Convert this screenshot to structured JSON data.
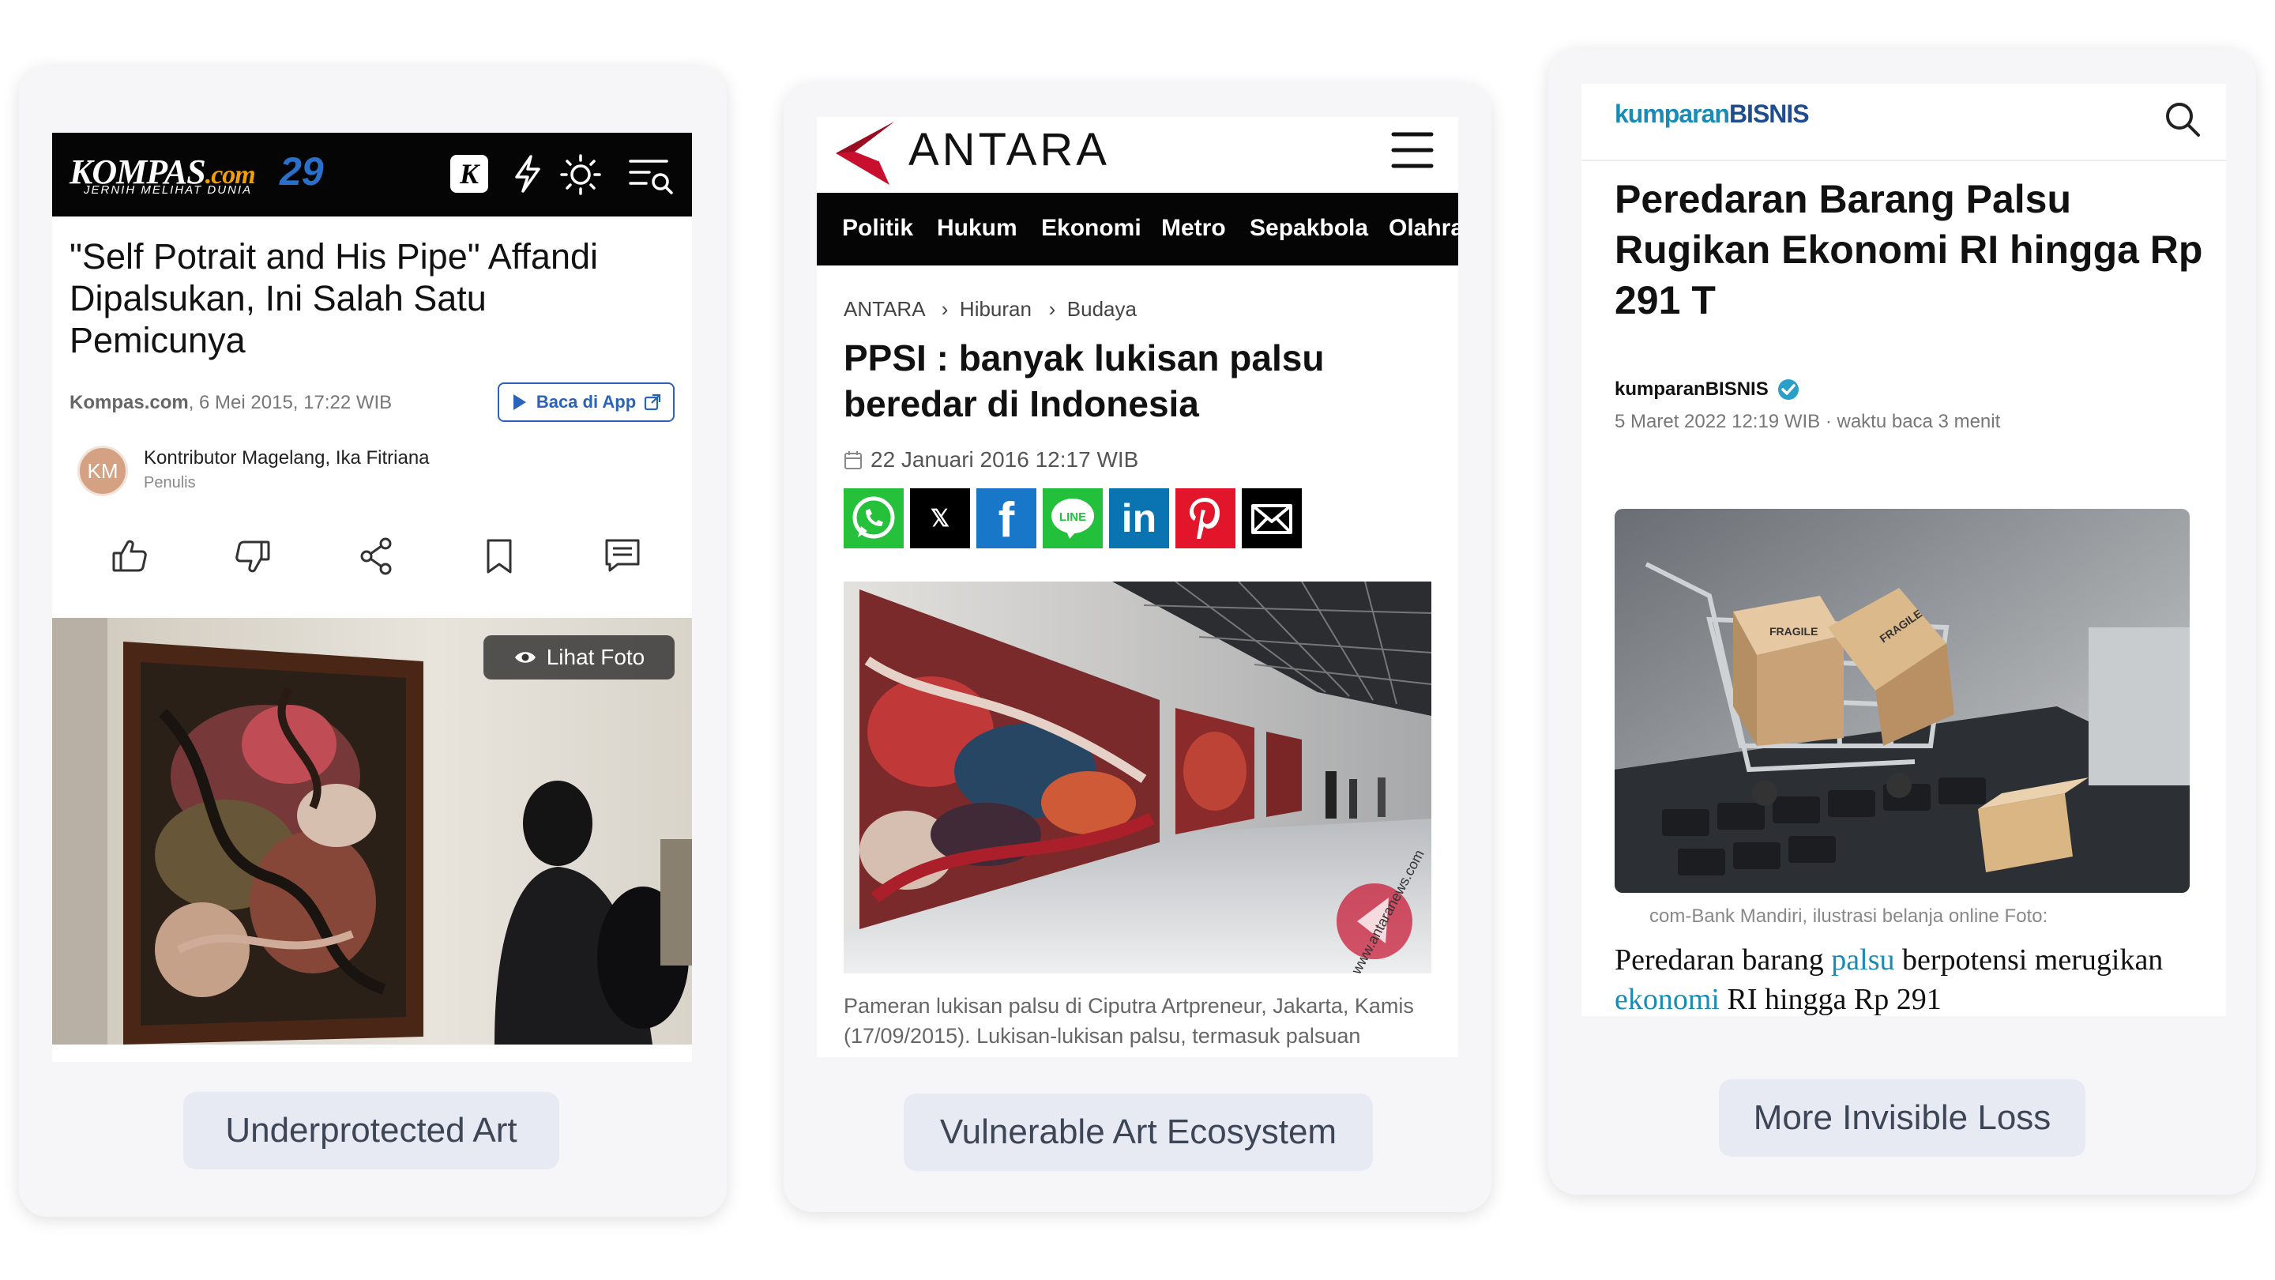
{
  "cards": [
    {
      "label": "Underprotected Art",
      "site": {
        "logo": "KOMPAS",
        "logo_suffix": ".com",
        "anniversary": "29",
        "tagline": "JERNIH MELIHAT DUNIA",
        "header_icons": [
          "k-icon",
          "lightning-icon",
          "sun-icon",
          "menu-search-icon"
        ]
      },
      "title": "\"Self Potrait and His Pipe\" Affandi Dipalsukan, Ini Salah Satu Pemicunya",
      "meta_source": "Kompas.com",
      "meta_date": ", 6 Mei 2015, 17:22 WIB",
      "app_button": "Baca di App",
      "author_initials": "KM",
      "author": "Kontributor Magelang, Ika Fitriana",
      "author_role": "Penulis",
      "actions": [
        "like-icon",
        "dislike-icon",
        "share-icon",
        "bookmark-icon",
        "comment-icon"
      ],
      "photo_button": "Lihat Foto"
    },
    {
      "label": "Vulnerable Art Ecosystem",
      "site": {
        "logo": "ANTARA",
        "nav": [
          "Politik",
          "Hukum",
          "Ekonomi",
          "Metro",
          "Sepakbola",
          "Olahra"
        ]
      },
      "breadcrumb": [
        "ANTARA",
        "Hiburan",
        "Budaya"
      ],
      "title": "PPSI : banyak lukisan palsu beredar di Indonesia",
      "date": "22 Januari 2016 12:17 WIB",
      "share_icons": [
        "whatsapp-icon",
        "x-icon",
        "facebook-icon",
        "line-icon",
        "linkedin-icon",
        "pinterest-icon",
        "email-icon"
      ],
      "photo_watermark": "www.antaranews.com",
      "caption": "Pameran lukisan palsu di Ciputra Artpreneur, Jakarta, Kamis (17/09/2015). Lukisan-lukisan palsu, termasuk palsuan"
    },
    {
      "label": "More Invisible Loss",
      "site": {
        "logo_a": "kumparan",
        "logo_b": "BISNIS"
      },
      "title": "Peredaran Barang Palsu Rugikan Ekonomi RI hingga Rp 291 T",
      "author": "kumparanBISNIS",
      "date": "5 Maret 2022 12:19 WIB",
      "read_time": " · waktu baca 3 menit",
      "photo_caption": "com-Bank Mandiri, ilustrasi belanja online Foto:",
      "body_parts": [
        "Peredaran barang ",
        "palsu",
        " berpotensi merugikan ",
        "ekonomi",
        " RI hingga Rp 291"
      ],
      "box_labels": [
        "FRAGILE",
        "FRAGILE"
      ]
    }
  ],
  "colors": {
    "card_bg": "#f6f6f8",
    "pill_bg": "#e7eaf3",
    "pill_text": "#3c4656",
    "antara_red": "#c8102e",
    "kompas_blue": "#2a63b8",
    "kumparan_blue": "#1a8bb5"
  }
}
